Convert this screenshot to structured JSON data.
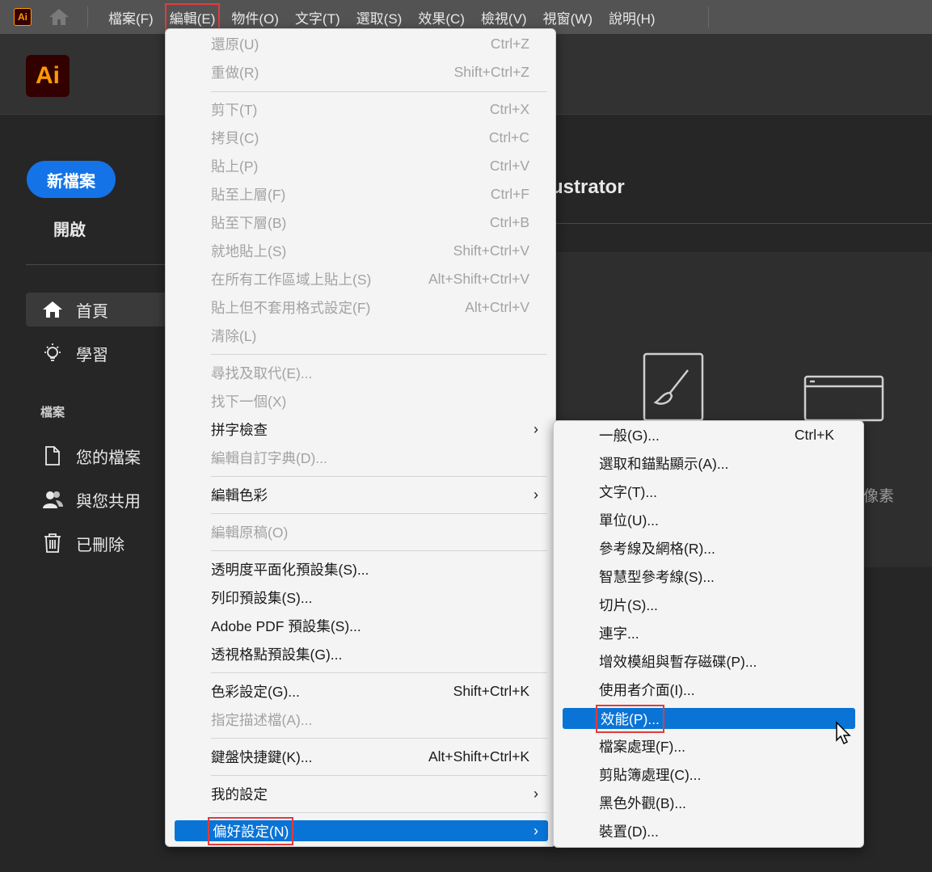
{
  "menubar": {
    "app_icon_text": "Ai",
    "home_icon": "home-icon",
    "menus": [
      {
        "label": "檔案(F)",
        "active": false
      },
      {
        "label": "編輯(E)",
        "active": true
      },
      {
        "label": "物件(O)",
        "active": false
      },
      {
        "label": "文字(T)",
        "active": false
      },
      {
        "label": "選取(S)",
        "active": false
      },
      {
        "label": "效果(C)",
        "active": false
      },
      {
        "label": "檢視(V)",
        "active": false
      },
      {
        "label": "視窗(W)",
        "active": false
      },
      {
        "label": "說明(H)",
        "active": false
      }
    ]
  },
  "home": {
    "logo_text": "Ai",
    "new_file": "新檔案",
    "open": "開啟",
    "nav": [
      {
        "label": "首頁",
        "icon": "home-icon"
      },
      {
        "label": "學習",
        "icon": "lightbulb-icon"
      }
    ],
    "files_section": "檔案",
    "files_nav": [
      {
        "label": "您的檔案",
        "icon": "document-icon"
      },
      {
        "label": "與您共用",
        "icon": "shared-users-icon"
      },
      {
        "label": "已刪除",
        "icon": "trash-icon"
      }
    ],
    "welcome_title_fragment": "ustrator",
    "preset_label_fragment": "像素"
  },
  "edit_menu": {
    "items": [
      {
        "label": "還原(U)",
        "shortcut": "Ctrl+Z",
        "enabled": false
      },
      {
        "label": "重做(R)",
        "shortcut": "Shift+Ctrl+Z",
        "enabled": false
      },
      {
        "label": "剪下(T)",
        "shortcut": "Ctrl+X",
        "enabled": false
      },
      {
        "label": "拷貝(C)",
        "shortcut": "Ctrl+C",
        "enabled": false
      },
      {
        "label": "貼上(P)",
        "shortcut": "Ctrl+V",
        "enabled": false
      },
      {
        "label": "貼至上層(F)",
        "shortcut": "Ctrl+F",
        "enabled": false
      },
      {
        "label": "貼至下層(B)",
        "shortcut": "Ctrl+B",
        "enabled": false
      },
      {
        "label": "就地貼上(S)",
        "shortcut": "Shift+Ctrl+V",
        "enabled": false
      },
      {
        "label": "在所有工作區域上貼上(S)",
        "shortcut": "Alt+Shift+Ctrl+V",
        "enabled": false
      },
      {
        "label": "貼上但不套用格式設定(F)",
        "shortcut": "Alt+Ctrl+V",
        "enabled": false
      },
      {
        "label": "清除(L)",
        "shortcut": "",
        "enabled": false
      },
      {
        "label": "尋找及取代(E)...",
        "shortcut": "",
        "enabled": false
      },
      {
        "label": "找下一個(X)",
        "shortcut": "",
        "enabled": false
      },
      {
        "label": "拼字檢查",
        "shortcut": "",
        "enabled": true,
        "submenu": true
      },
      {
        "label": "編輯自訂字典(D)...",
        "shortcut": "",
        "enabled": false
      },
      {
        "label": "編輯色彩",
        "shortcut": "",
        "enabled": true,
        "submenu": true
      },
      {
        "label": "編輯原稿(O)",
        "shortcut": "",
        "enabled": false
      },
      {
        "label": "透明度平面化預設集(S)...",
        "shortcut": "",
        "enabled": true
      },
      {
        "label": "列印預設集(S)...",
        "shortcut": "",
        "enabled": true
      },
      {
        "label": "Adobe PDF 預設集(S)...",
        "shortcut": "",
        "enabled": true
      },
      {
        "label": "透視格點預設集(G)...",
        "shortcut": "",
        "enabled": true
      },
      {
        "label": "色彩設定(G)...",
        "shortcut": "Shift+Ctrl+K",
        "enabled": true
      },
      {
        "label": "指定描述檔(A)...",
        "shortcut": "",
        "enabled": false
      },
      {
        "label": "鍵盤快捷鍵(K)...",
        "shortcut": "Alt+Shift+Ctrl+K",
        "enabled": true
      },
      {
        "label": "我的設定",
        "shortcut": "",
        "enabled": true,
        "submenu": true
      },
      {
        "label": "偏好設定(N)",
        "shortcut": "",
        "enabled": true,
        "submenu": true,
        "highlighted": true
      }
    ],
    "arrow": "›"
  },
  "preferences_menu": {
    "items": [
      {
        "label": "一般(G)...",
        "shortcut": "Ctrl+K"
      },
      {
        "label": "選取和錨點顯示(A)...",
        "shortcut": ""
      },
      {
        "label": "文字(T)...",
        "shortcut": ""
      },
      {
        "label": "單位(U)...",
        "shortcut": ""
      },
      {
        "label": "參考線及網格(R)...",
        "shortcut": ""
      },
      {
        "label": "智慧型參考線(S)...",
        "shortcut": ""
      },
      {
        "label": "切片(S)...",
        "shortcut": ""
      },
      {
        "label": "連字...",
        "shortcut": ""
      },
      {
        "label": "增效模組與暫存磁碟(P)...",
        "shortcut": ""
      },
      {
        "label": "使用者介面(I)...",
        "shortcut": ""
      },
      {
        "label": "效能(P)...",
        "shortcut": "",
        "highlighted": true
      },
      {
        "label": "檔案處理(F)...",
        "shortcut": ""
      },
      {
        "label": "剪貼簿處理(C)...",
        "shortcut": ""
      },
      {
        "label": "黑色外觀(B)...",
        "shortcut": ""
      },
      {
        "label": "裝置(D)...",
        "shortcut": ""
      }
    ]
  },
  "colors": {
    "highlight": "#0a74d6",
    "annotation_red": "#e23b3b",
    "brand_orange": "#ff9a00",
    "new_button_blue": "#1473e6"
  }
}
